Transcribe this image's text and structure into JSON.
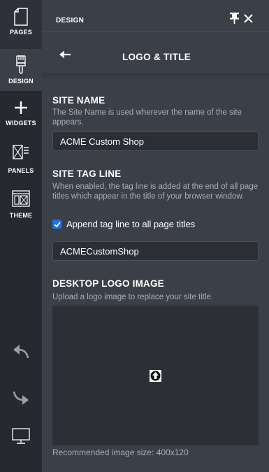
{
  "rail": {
    "pages": "PAGES",
    "design": "DESIGN",
    "widgets": "WIDGETS",
    "panels": "PANELS",
    "theme": "THEME"
  },
  "header": {
    "title": "DESIGN"
  },
  "sub_header": {
    "title": "LOGO & TITLE"
  },
  "site_name": {
    "title": "SITE NAME",
    "description": "The Site Name is used wherever the name of the site appears.",
    "value": "ACME Custom Shop"
  },
  "site_tag_line": {
    "title": "SITE TAG LINE",
    "description": "When enabled, the tag line is added at the end of all page titles which appear in the title of your browser window.",
    "checkbox_label": "Append tag line to all page titles",
    "checked": true,
    "value": "ACMECustomShop"
  },
  "desktop_logo": {
    "title": "DESKTOP LOGO IMAGE",
    "description": "Upload a logo image to replace your site title.",
    "hint": "Recommended image size: 400x120"
  },
  "colors": {
    "rail_bg": "#262930",
    "panel_bg": "#3b3f48",
    "field_bg": "#2b2e35",
    "checkbox": "#1a73e8",
    "muted_text": "#a9adb6"
  },
  "icons": [
    "page-icon",
    "paintbrush-icon",
    "plus-icon",
    "panels-icon",
    "theme-icon",
    "undo-icon",
    "redo-icon",
    "monitor-icon",
    "pin-icon",
    "close-icon",
    "back-arrow-icon",
    "upload-icon",
    "checkmark-icon"
  ]
}
